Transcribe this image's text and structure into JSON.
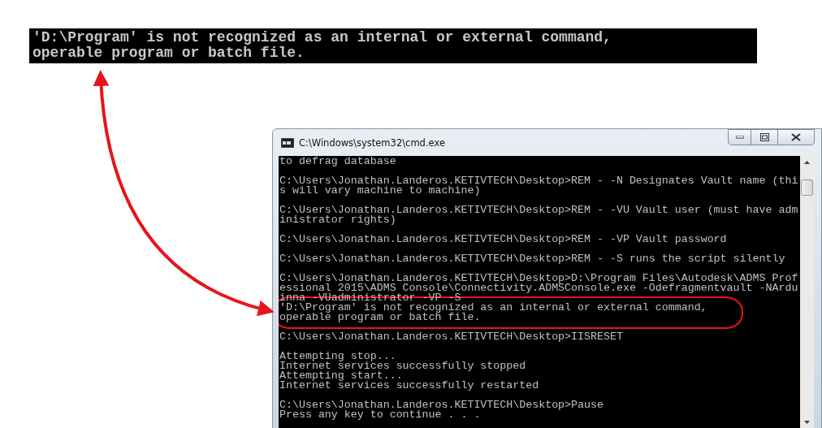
{
  "callout": {
    "lines": [
      "'D:\\Program' is not recognized as an internal or external command,",
      "operable program or batch file."
    ]
  },
  "window": {
    "title": "C:\\Windows\\system32\\cmd.exe"
  },
  "console": {
    "blocks": [
      [
        {
          "text": "to defrag database",
          "circled": false
        }
      ],
      [
        {
          "text": "C:\\Users\\Jonathan.Landeros.KETIVTECH\\Desktop>REM - -N Designates Vault name (thi",
          "circled": false
        },
        {
          "text": "s will vary machine to machine)",
          "circled": false
        }
      ],
      [
        {
          "text": "C:\\Users\\Jonathan.Landeros.KETIVTECH\\Desktop>REM - -VU Vault user (must have adm",
          "circled": false
        },
        {
          "text": "inistrator rights)",
          "circled": false
        }
      ],
      [
        {
          "text": "C:\\Users\\Jonathan.Landeros.KETIVTECH\\Desktop>REM - -VP Vault password",
          "circled": false
        }
      ],
      [
        {
          "text": "C:\\Users\\Jonathan.Landeros.KETIVTECH\\Desktop>REM - -S runs the script silently",
          "circled": false
        }
      ],
      [
        {
          "text": "C:\\Users\\Jonathan.Landeros.KETIVTECH\\Desktop>D:\\Program Files\\Autodesk\\ADMS Prof",
          "circled": false
        },
        {
          "text": "essional 2015\\ADMS Console\\Connectivity.ADMSConsole.exe -Odefragmentvault -NArdu",
          "circled": false
        },
        {
          "text": "inna -VUadministrator -VP -S",
          "circled": false
        },
        {
          "text": "'D:\\Program' is not recognized as an internal or external command,",
          "circled": true
        },
        {
          "text": "operable program or batch file.",
          "circled": true
        }
      ],
      [
        {
          "text": "C:\\Users\\Jonathan.Landeros.KETIVTECH\\Desktop>IISRESET",
          "circled": false
        }
      ],
      [
        {
          "text": "Attempting stop...",
          "circled": false
        },
        {
          "text": "Internet services successfully stopped",
          "circled": false
        },
        {
          "text": "Attempting start...",
          "circled": false
        },
        {
          "text": "Internet services successfully restarted",
          "circled": false
        }
      ],
      [
        {
          "text": "C:\\Users\\Jonathan.Landeros.KETIVTECH\\Desktop>Pause",
          "circled": false
        },
        {
          "text": "Press any key to continue . . .",
          "circled": false
        }
      ]
    ]
  }
}
